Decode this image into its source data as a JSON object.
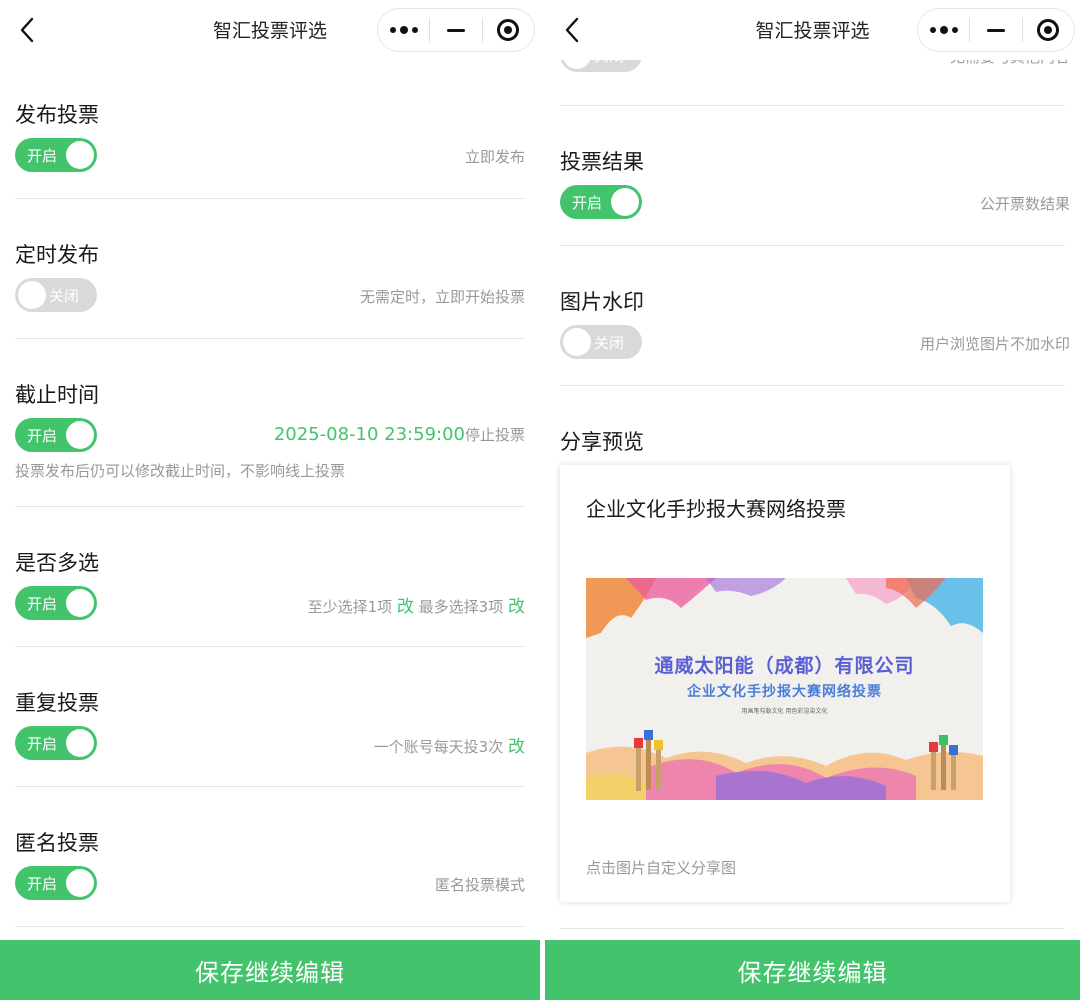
{
  "nav": {
    "title": "智汇投票评选"
  },
  "colors": {
    "accent": "#43c46c",
    "muted": "#999999",
    "toggle_off": "#d9d9d9"
  },
  "icons": {
    "back": "chevron-left-icon",
    "more": "more-dots-icon",
    "minimize": "minimize-icon",
    "close": "target-close-icon"
  },
  "left": {
    "rows": [
      {
        "title": "发布投票",
        "on": true,
        "toggle_label": "开启",
        "desc": "立即发布"
      },
      {
        "title": "定时发布",
        "on": false,
        "toggle_label": "关闭",
        "desc": "无需定时，立即开始投票"
      },
      {
        "title": "截止时间",
        "on": true,
        "toggle_label": "开启",
        "deadline": "2025-08-10  23:59:00",
        "deadline_suffix": "停止投票",
        "note": "投票发布后仍可以修改截止时间，不影响线上投票"
      },
      {
        "title": "是否多选",
        "on": true,
        "toggle_label": "开启",
        "min_text": "至少选择1项",
        "edit1": "改",
        "max_text": "最多选择3项",
        "edit2": "改"
      },
      {
        "title": "重复投票",
        "on": true,
        "toggle_label": "开启",
        "desc": "一个账号每天投3次",
        "edit": "改"
      },
      {
        "title": "匿名投票",
        "on": true,
        "toggle_label": "开启",
        "desc": "匿名投票模式"
      }
    ]
  },
  "right": {
    "partial_toggle_label": "关闭",
    "partial_desc": "无需要与其他内容",
    "rows": [
      {
        "title": "投票结果",
        "on": true,
        "toggle_label": "开启",
        "desc": "公开票数结果"
      },
      {
        "title": "图片水印",
        "on": false,
        "toggle_label": "关闭",
        "desc": "用户浏览图片不加水印"
      }
    ],
    "share": {
      "section_title": "分享预览",
      "card_title": "企业文化手抄报大赛网络投票",
      "poster_company": "通威太阳能（成都）有限公司",
      "poster_subtitle": "企业文化手抄报大赛网络投票",
      "poster_small": "用画笔勾勒文化    用色彩渲染文化",
      "hint": "点击图片自定义分享图"
    }
  },
  "bottom": {
    "save_label": "保存继续编辑"
  }
}
